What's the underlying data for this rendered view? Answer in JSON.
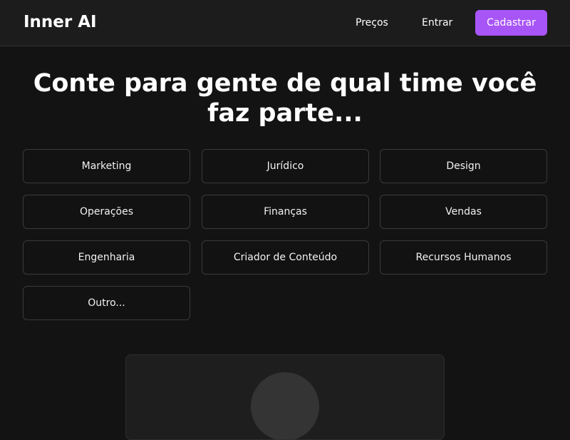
{
  "header": {
    "logo": "Inner AI",
    "nav": {
      "pricing": "Preços",
      "login": "Entrar",
      "signup": "Cadastrar"
    },
    "accent_color": "#a855f7"
  },
  "main": {
    "heading": "Conte para gente de qual time você faz parte...",
    "teams": [
      "Marketing",
      "Jurídico",
      "Design",
      "Operações",
      "Finanças",
      "Vendas",
      "Engenharia",
      "Criador de Conteúdo",
      "Recursos Humanos",
      "Outro..."
    ]
  }
}
